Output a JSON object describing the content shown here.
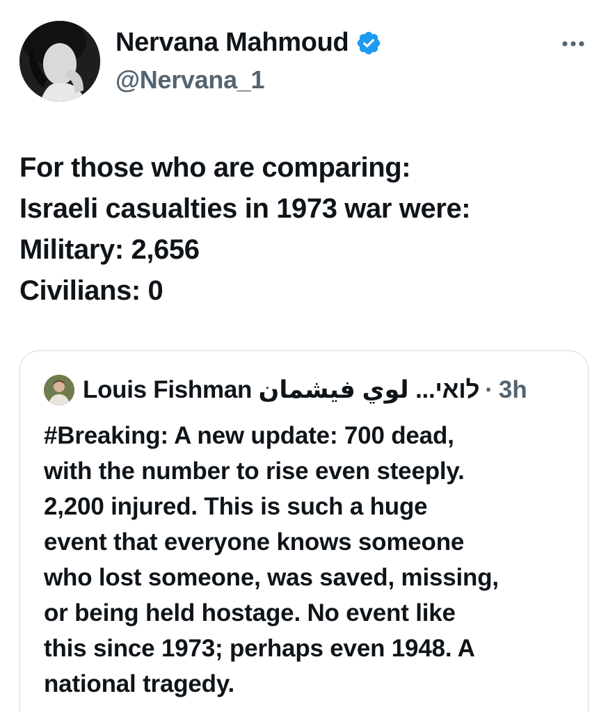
{
  "author": {
    "display_name": "Nervana Mahmoud",
    "handle": "@Nervana_1",
    "avatar_icon": "profile-photo",
    "verified_color": "#1d9bf0"
  },
  "more_icon": "more-horizontal-icon",
  "tweet": {
    "lines": [
      "For those who are comparing:",
      "Israeli casualties in 1973 war were:",
      "Military: 2,656",
      "Civilians: 0"
    ]
  },
  "quoted_tweet": {
    "display_name": "Louis Fishman לואי... لوي فيشمان",
    "separator": "·",
    "time": "3h",
    "lines": [
      "#Breaking: A new update: 700 dead,",
      "with the number to rise even steeply.",
      "2,200 injured. This is such a huge",
      "event that everyone knows someone",
      "who lost someone, was saved, missing,",
      "or being held hostage. No event like",
      "this since 1973; perhaps even 1948. A",
      "national tragedy."
    ]
  }
}
